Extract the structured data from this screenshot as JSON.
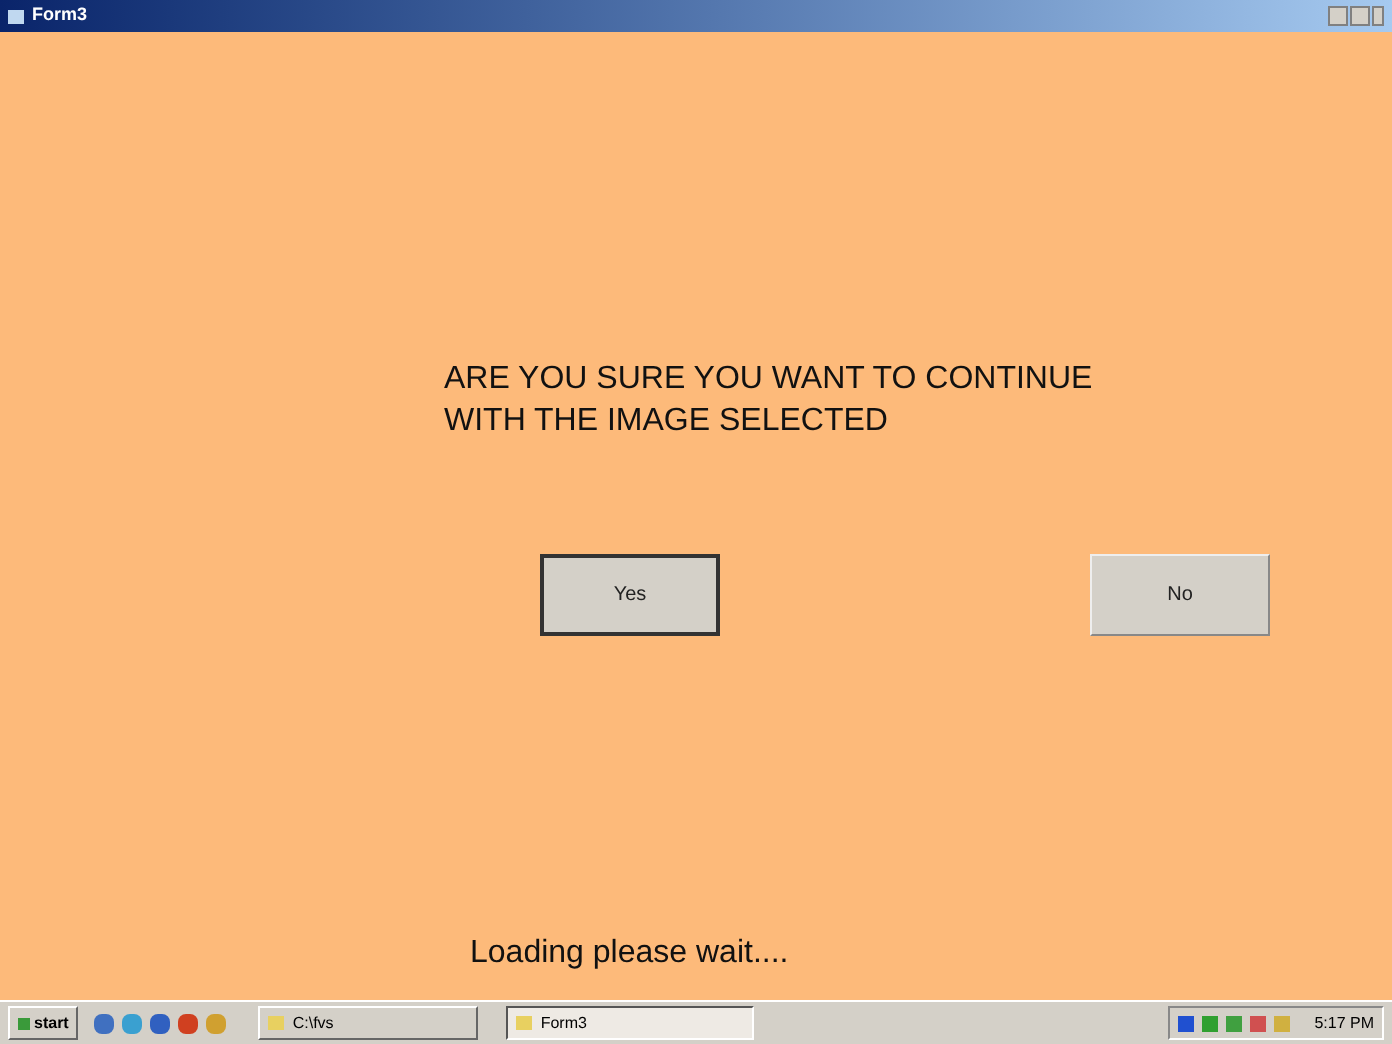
{
  "window": {
    "title": "Form3"
  },
  "question": [
    "ARE YOU SURE YOU WANT TO CONTINUE",
    "WITH THE IMAGE SELECTED"
  ],
  "buttons": [
    {
      "label": "Yes",
      "default": true
    },
    {
      "label": "No",
      "default": false
    }
  ],
  "status": "Loading please wait....",
  "taskbar": {
    "start": "start",
    "tasks": [
      {
        "label": "C:\\fvs",
        "selected": false
      },
      {
        "label": "Form3",
        "selected": true
      }
    ],
    "clock": "5:17 PM"
  }
}
